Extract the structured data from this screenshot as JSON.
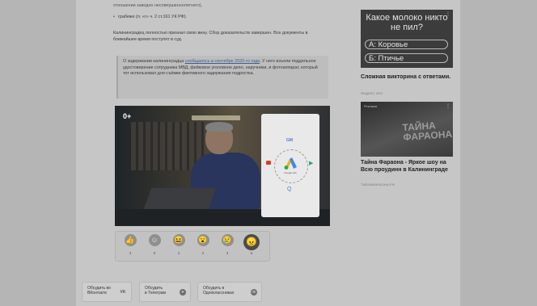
{
  "article": {
    "cut_line": "отношении заводно несовершеннолетнего),",
    "bullet": "грабеже (п. «г» ч. 2 ст.161 УК РФ).",
    "paragraph": "Калининградец полностью признал свою вину. Сбор доказательств завершен. Все документы в ближайшее время поступят в суд.",
    "quote_before_link": "О задержании калининградца ",
    "quote_link": "сообщалось в сентябре 2020-го года",
    "quote_after_link": ". У него изъяли поддельное удостоверение сотрудника МВД, фейковое уголовное дело, наручники, и фотоаппарат, который тот использовал для съёмки фиктивного задержания подростка."
  },
  "video": {
    "age_rating": "0+",
    "panel_top_label": "GM",
    "panel_caption": "Google Ads",
    "panel_bottom_label": "Q",
    "panel_right_label": "▶"
  },
  "reactions": [
    {
      "icon": "thumbs-up-icon",
      "glyph": "👍",
      "count": "3"
    },
    {
      "icon": "smile-icon",
      "glyph": "☺",
      "count": "0"
    },
    {
      "icon": "laugh-icon",
      "glyph": "😆",
      "count": "1"
    },
    {
      "icon": "surprised-icon",
      "glyph": "😮",
      "count": "2"
    },
    {
      "icon": "sad-icon",
      "glyph": "😢",
      "count": "3"
    },
    {
      "icon": "angry-icon",
      "glyph": "😠",
      "count": "6"
    }
  ],
  "discuss": [
    {
      "line1": "Обсудить во",
      "line2": "ВКонтакте",
      "icon": "vk-icon",
      "glyph": "VK"
    },
    {
      "line1": "Обсудить",
      "line2": "в Телеграм",
      "icon": "telegram-icon",
      "glyph": "➤"
    },
    {
      "line1": "Обсудить в",
      "line2": "Одноклассниках",
      "icon": "odnoklassniki-icon",
      "glyph": "ok"
    }
  ],
  "sidebar": {
    "ad1": {
      "question": "Какое молоко никто не пил?",
      "options": [
        "А:  Коровье",
        "Б:  Птичье"
      ],
      "title": "Сложная викторина с ответами.",
      "source": "ЯНДЕКС.ЗЕН"
    },
    "ad2": {
      "label": "Реклама",
      "image_word": "ТАЙНА ФАРАОНА",
      "title": "Тайна Фараона - Яркое шоу на Всю проудинн в Калининграде",
      "source": "ТАЙНАФАРАОНА.РФ"
    }
  },
  "colors": {
    "page_bg": "#b5b5b5",
    "column_bg": "#c6c6c6",
    "link": "#3c5d8f"
  }
}
